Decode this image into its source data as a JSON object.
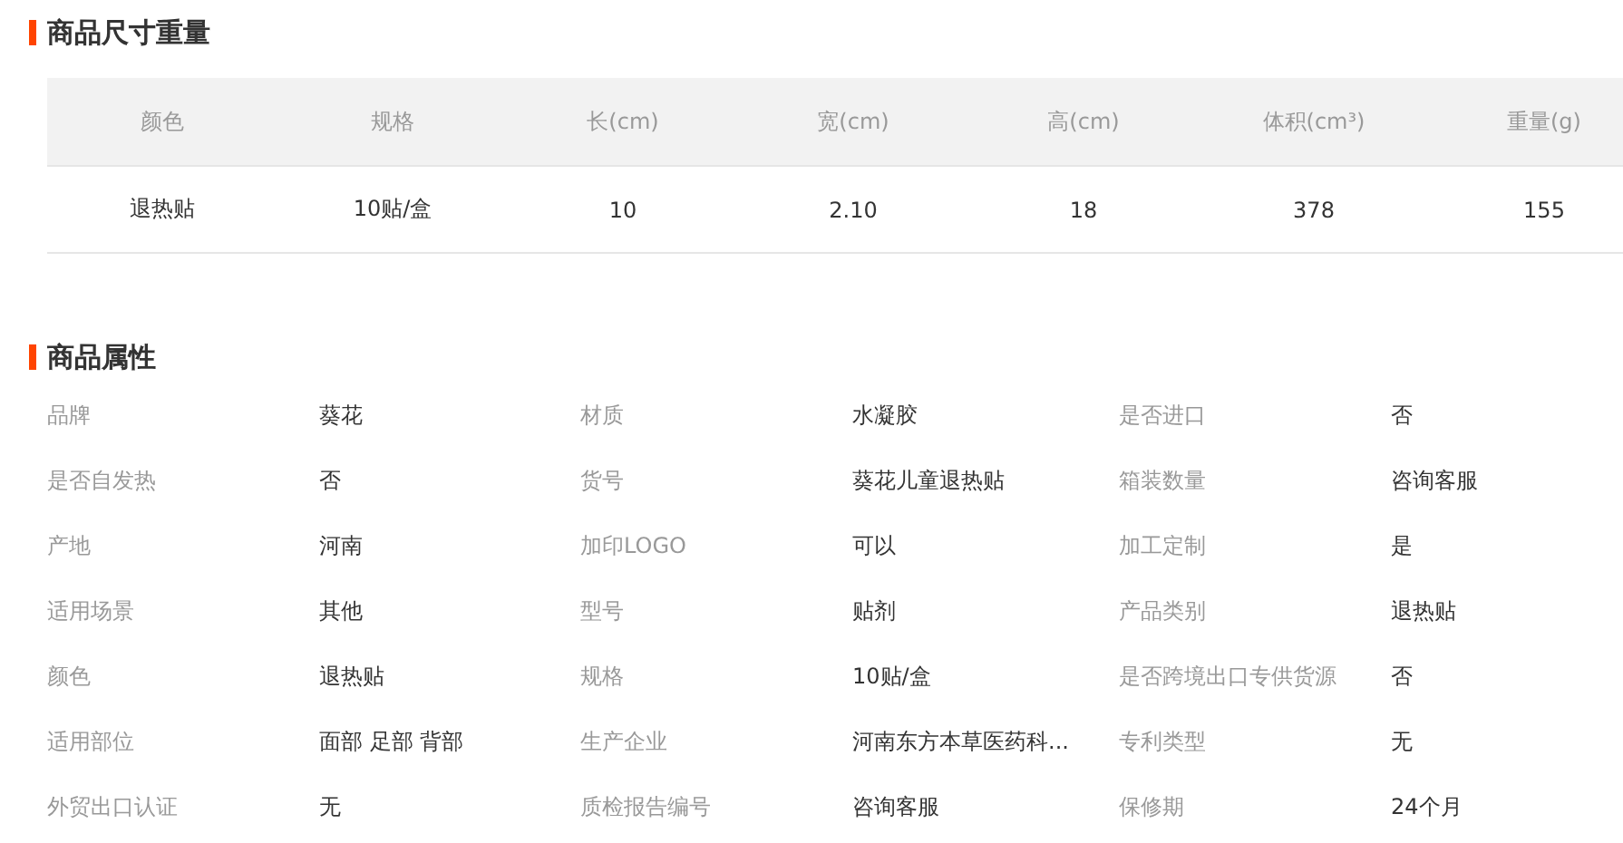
{
  "dimensions": {
    "title": "商品尺寸重量",
    "columns": [
      "颜色",
      "规格",
      "长(cm)",
      "宽(cm)",
      "高(cm)",
      "体积(cm³)",
      "重量(g)"
    ],
    "rows": [
      [
        "退热贴",
        "10贴/盒",
        "10",
        "2.10",
        "18",
        "378",
        "155"
      ]
    ]
  },
  "attributes": {
    "title": "商品属性",
    "items": [
      {
        "label": "品牌",
        "value": "葵花"
      },
      {
        "label": "材质",
        "value": "水凝胶"
      },
      {
        "label": "是否进口",
        "value": "否"
      },
      {
        "label": "是否自发热",
        "value": "否"
      },
      {
        "label": "货号",
        "value": "葵花儿童退热贴"
      },
      {
        "label": "箱装数量",
        "value": "咨询客服"
      },
      {
        "label": "产地",
        "value": "河南"
      },
      {
        "label": "加印LOGO",
        "value": "可以"
      },
      {
        "label": "加工定制",
        "value": "是"
      },
      {
        "label": "适用场景",
        "value": "其他"
      },
      {
        "label": "型号",
        "value": "贴剂"
      },
      {
        "label": "产品类别",
        "value": "退热贴"
      },
      {
        "label": "颜色",
        "value": "退热贴"
      },
      {
        "label": "规格",
        "value": "10贴/盒"
      },
      {
        "label": "是否跨境出口专供货源",
        "value": "否"
      },
      {
        "label": "适用部位",
        "value": "面部 足部 背部"
      },
      {
        "label": "生产企业",
        "value": "河南东方本草医药科..."
      },
      {
        "label": "专利类型",
        "value": "无"
      },
      {
        "label": "外贸出口认证",
        "value": "无"
      },
      {
        "label": "质检报告编号",
        "value": "咨询客服"
      },
      {
        "label": "保修期",
        "value": "24个月"
      }
    ]
  }
}
